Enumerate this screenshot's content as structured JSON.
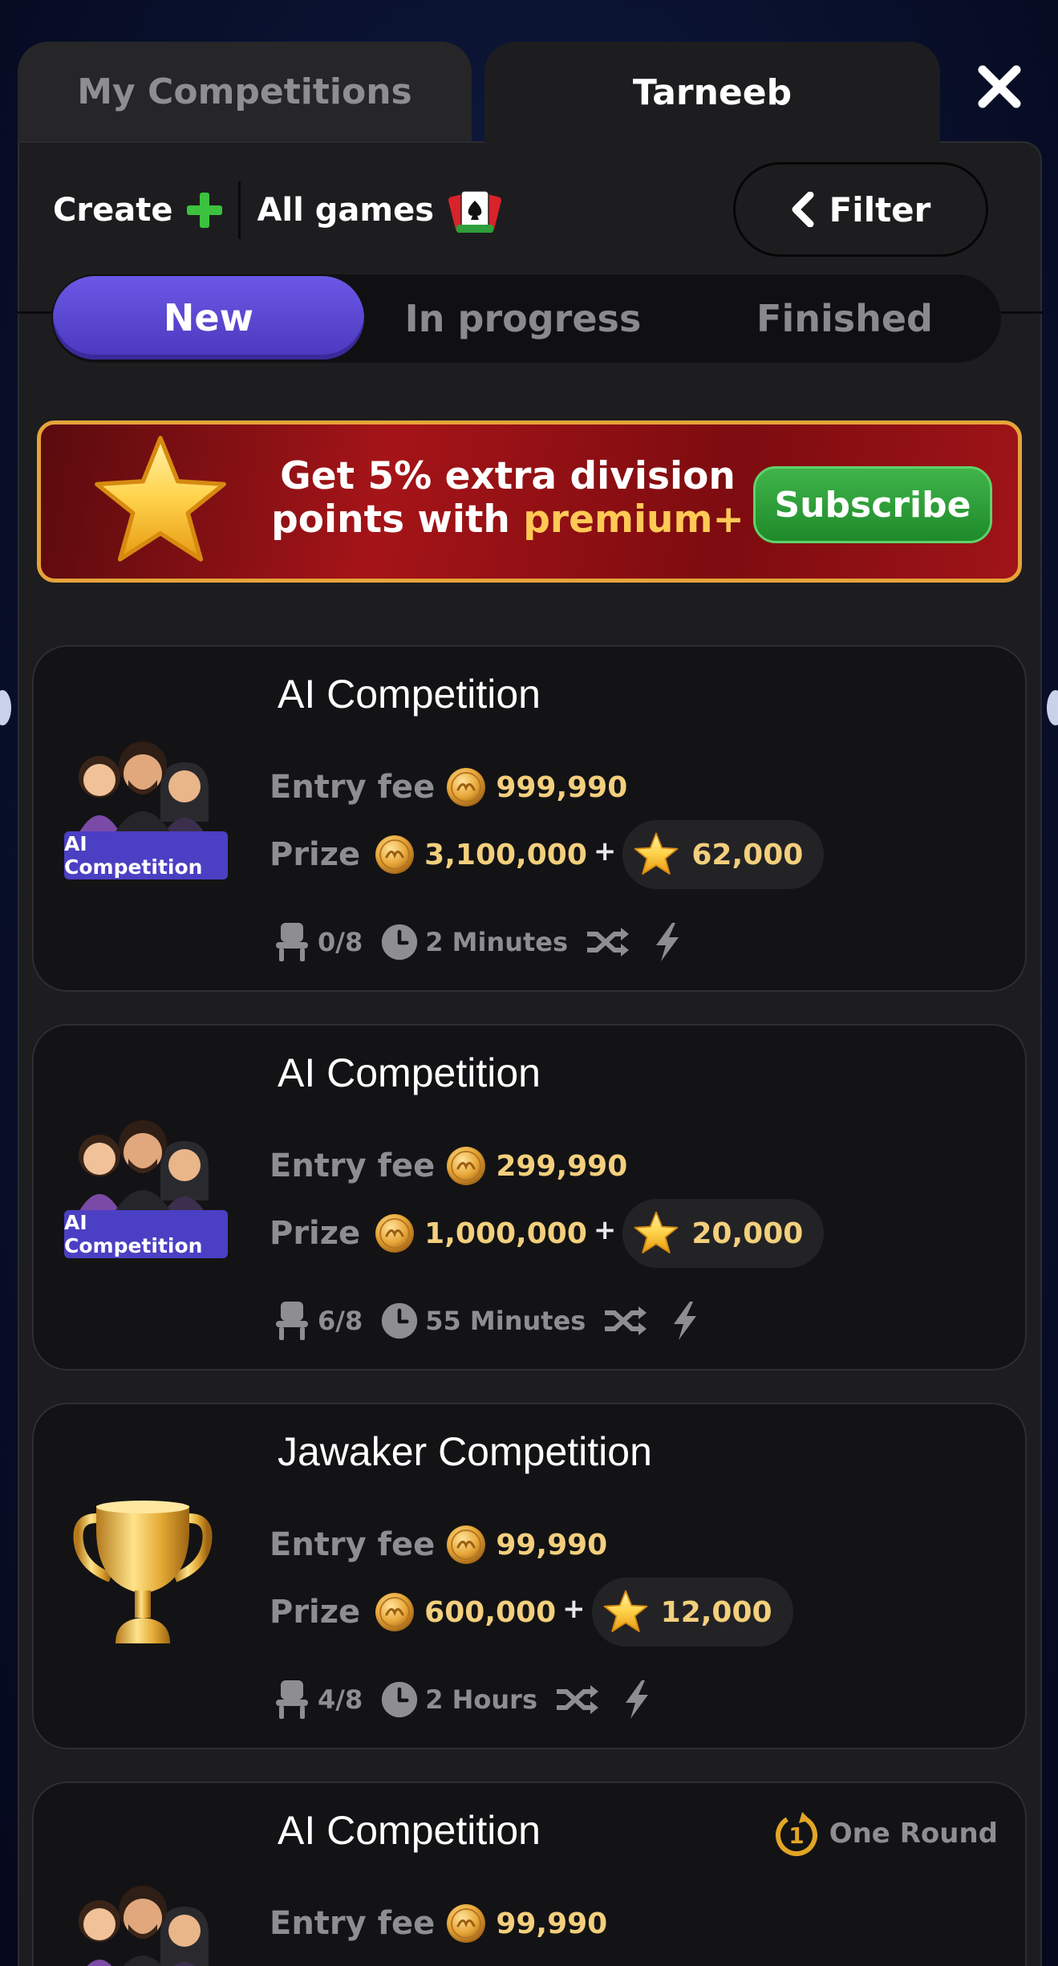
{
  "tabs": {
    "mine": "My Competitions",
    "game": "Tarneeb"
  },
  "toolbar": {
    "create": "Create",
    "all_games": "All games",
    "filter": "Filter"
  },
  "segments": {
    "new": "New",
    "in_progress": "In progress",
    "finished": "Finished",
    "active": "New"
  },
  "banner": {
    "line1": "Get 5% extra division",
    "line2_prefix": "points with",
    "line2_highlight": "premium+",
    "button": "Subscribe"
  },
  "labels": {
    "entry_fee": "Entry fee",
    "prize": "Prize",
    "plus": "+"
  },
  "competitions": [
    {
      "title": "AI Competition",
      "badge": "AI Competition",
      "entry_fee": "999,990",
      "prize": "3,100,000",
      "stars": "62,000",
      "seats": "0/8",
      "duration": "2 Minutes"
    },
    {
      "title": "AI Competition",
      "badge": "AI Competition",
      "entry_fee": "299,990",
      "prize": "1,000,000",
      "stars": "20,000",
      "seats": "6/8",
      "duration": "55 Minutes"
    },
    {
      "title": "Jawaker Competition",
      "badge": "",
      "entry_fee": "99,990",
      "prize": "600,000",
      "stars": "12,000",
      "seats": "4/8",
      "duration": "2 Hours"
    },
    {
      "title": "AI Competition",
      "badge": "AI Competition",
      "entry_fee": "99,990",
      "round_number": "1",
      "round_label": "One Round"
    }
  ],
  "colors": {
    "accent_purple": "#5b48d6",
    "coin_gold": "#f3cf7d",
    "subscribe_green": "#2e9e3a",
    "banner_red": "#a51418"
  }
}
